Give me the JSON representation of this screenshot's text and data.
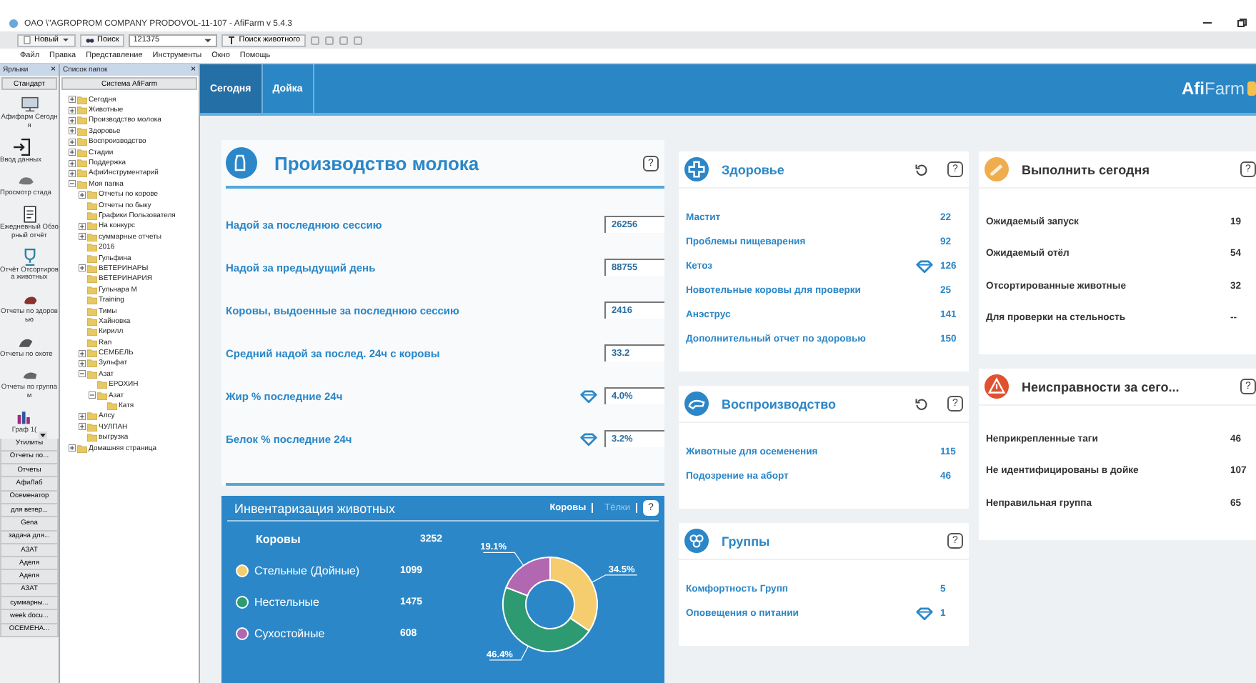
{
  "window": {
    "title": "OAO \\\"AGROPROM COMPANY PRODOVOL-11-107 - AfiFarm v 5.4.3"
  },
  "toolbar": {
    "new_button": "Новый",
    "search_button": "Поиск",
    "search_field": {
      "value": "121375"
    },
    "animal_search_button": "Поиск животного"
  },
  "menu": [
    "Файл",
    "Правка",
    "Представление",
    "Инструменты",
    "Окно",
    "Помощь"
  ],
  "shortcuts": {
    "title": "Ярлыки",
    "close": "×",
    "group": "Стандарт",
    "items": [
      {
        "label": "Афифарм Сегодня"
      },
      {
        "label": "Ввод данных"
      },
      {
        "label": "Просмотр стада"
      },
      {
        "label": "Ежедневный Обзорный отчёт"
      },
      {
        "label": "Отчёт Отсортирова животных"
      },
      {
        "label": "Отчеты по здоровью"
      },
      {
        "label": "Отчеты по охоте"
      },
      {
        "label": "Отчеты по группам"
      },
      {
        "label": "Граф 1("
      }
    ],
    "groups": [
      "Утилиты",
      "Отчеты по...",
      "Отчеты",
      "АфиЛаб",
      "Осеменатор",
      "для ветер...",
      "Gena",
      "задача для...",
      "АЗАТ",
      "Аделя",
      "Аделя",
      "АЗАТ",
      "суммарны...",
      "week docu...",
      "ОСЕМЕНА..."
    ]
  },
  "folders": {
    "title": "Список папок",
    "close": "×",
    "root": "Система AfiFarm",
    "tree": [
      {
        "label": "Сегодня",
        "expanded": false
      },
      {
        "label": "Животные",
        "expanded": false
      },
      {
        "label": "Производство молока",
        "expanded": false
      },
      {
        "label": "Здоровье",
        "expanded": false
      },
      {
        "label": "Воспроизводство",
        "expanded": false
      },
      {
        "label": "Стадии",
        "expanded": false
      },
      {
        "label": "Поддержка",
        "expanded": false
      },
      {
        "label": "АфиИнструментарий",
        "expanded": false
      },
      {
        "label": "Моя папка",
        "expanded": true,
        "children": [
          {
            "label": "Отчеты по корове",
            "expanded": false
          },
          {
            "label": "Отчеты по быку"
          },
          {
            "label": "Графики Пользователя"
          },
          {
            "label": "На конкурс",
            "expanded": false
          },
          {
            "label": "суммарные отчеты",
            "expanded": false
          },
          {
            "label": "2016"
          },
          {
            "label": "Гульфина"
          },
          {
            "label": "ВЕТЕРИНАРЫ",
            "expanded": false
          },
          {
            "label": "ВЕТЕРИНАРИЯ"
          },
          {
            "label": "Гульнара М"
          },
          {
            "label": "Training"
          },
          {
            "label": "Тимы"
          },
          {
            "label": "Хайновка"
          },
          {
            "label": "Кирилл"
          },
          {
            "label": "Ran"
          },
          {
            "label": "СЕМБЕЛЬ",
            "expanded": false
          },
          {
            "label": "Зульфат",
            "expanded": false
          },
          {
            "label": "Азат",
            "expanded": true,
            "children": [
              {
                "label": "ЕРОХИН"
              },
              {
                "label": "Азат",
                "expanded": true,
                "children": [
                  {
                    "label": "Катя"
                  }
                ]
              }
            ]
          },
          {
            "label": "Алсу",
            "expanded": false
          },
          {
            "label": "ЧУЛПАН",
            "expanded": false
          },
          {
            "label": "выгрузка"
          }
        ]
      },
      {
        "label": "Домашняя страница",
        "expanded": false
      }
    ]
  },
  "header": {
    "tabs": [
      {
        "label": "Сегодня",
        "selected": true
      },
      {
        "label": "Дойка",
        "selected": false
      }
    ],
    "logo": "**Afi**Farm"
  },
  "milk": {
    "title": "Производство молока",
    "help": "?",
    "rows": [
      {
        "label": "Надой за последнюю сессию",
        "value": "26256",
        "flag": false
      },
      {
        "label": "Надой за предыдущий день",
        "value": "88755",
        "flag": false
      },
      {
        "label": "Коровы, выдоенные за последнюю сессию",
        "value": "2416",
        "flag": false
      },
      {
        "label": "Средний надой за послед. 24ч с коровы",
        "value": "33.2",
        "flag": false
      },
      {
        "label": "Жир % последние 24ч",
        "value": "4.0%",
        "flag": true
      },
      {
        "label": "Белок % последние 24ч",
        "value": "3.2%",
        "flag": true
      }
    ]
  },
  "inventory": {
    "title": "Инвентаризация животных",
    "tabs": [
      {
        "label": "Коровы",
        "selected": true
      },
      {
        "label": "Тёлки",
        "selected": false
      }
    ],
    "help": "?",
    "total": {
      "label": "Коровы",
      "value": "3252"
    },
    "rows": [
      {
        "label": "Стельные (Дойные)",
        "value": "1099",
        "color": "#f5cd6e"
      },
      {
        "label": "Нестельные",
        "value": "1475",
        "color": "#2d9a72"
      },
      {
        "label": "Сухостойные",
        "value": "608",
        "color": "#b268b0"
      }
    ],
    "chart_data": {
      "type": "donut",
      "values": [
        34.5,
        46.4,
        19.1
      ],
      "value_labels": [
        "34.5%",
        "46.4%",
        "19.1%"
      ]
    }
  },
  "widget_columns": [
    {
      "cards": [
        {
          "title": "Здоровье",
          "color": "#2b87c8",
          "kind": "links",
          "refresh": true,
          "help": "?",
          "rows": [
            {
              "label": "Мастит",
              "value": "22",
              "flag": false
            },
            {
              "label": "Проблемы пищеварения",
              "value": "92",
              "flag": false
            },
            {
              "label": "Кетоз",
              "value": "126",
              "flag": true
            },
            {
              "label": "Новотельные коровы для проверки",
              "value": "25",
              "flag": false
            },
            {
              "label": "Анэструс",
              "value": "141",
              "flag": false
            },
            {
              "label": "Дополнительный отчет по здоровью",
              "value": "150",
              "flag": false
            }
          ]
        },
        {
          "title": "Воспроизводство",
          "color": "#2b87c8",
          "kind": "links",
          "refresh": true,
          "help": "?",
          "rows": [
            {
              "label": "Животные для осеменения",
              "value": "115",
              "flag": false
            },
            {
              "label": "Подозрение на аборт",
              "value": "46",
              "flag": false
            }
          ]
        },
        {
          "title": "Группы",
          "color": "#2b87c8",
          "kind": "links",
          "refresh": false,
          "help": "?",
          "rows": [
            {
              "label": "Комфортность Групп",
              "value": "5",
              "flag": false
            },
            {
              "label": "Оповещения о питании",
              "value": "1",
              "flag": true
            }
          ]
        }
      ]
    },
    {
      "cards": [
        {
          "title": "Выполнить сегодня",
          "color": "#f0ad4e",
          "kind": "plain",
          "refresh": false,
          "help": "?",
          "rows": [
            {
              "label": "Ожидаемый запуск",
              "value": "19",
              "flag": false
            },
            {
              "label": "Ожидаемый отёл",
              "value": "54",
              "flag": false
            },
            {
              "label": "Отсортированные животные",
              "value": "32",
              "flag": false
            },
            {
              "label": "Для проверки на стельность",
              "value": "--",
              "flag": false
            }
          ]
        },
        {
          "title": "Неисправности за сего...",
          "color": "#e0522f",
          "kind": "plain",
          "refresh": false,
          "help": "?",
          "rows": [
            {
              "label": "Неприкрепленные таги",
              "value": "46",
              "flag": false
            },
            {
              "label": "Не идентифицированы в дойке",
              "value": "107",
              "flag": false
            },
            {
              "label": "Неправильная группа",
              "value": "65",
              "flag": false
            }
          ]
        }
      ]
    }
  ]
}
